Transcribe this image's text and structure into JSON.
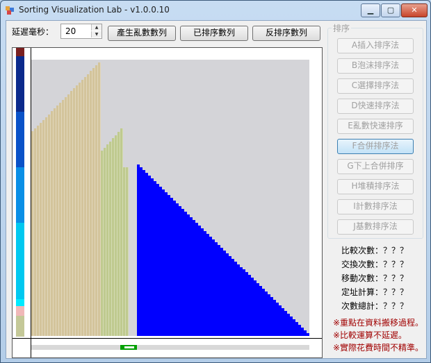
{
  "window": {
    "title": "Sorting Visualization Lab - v1.0.0.10",
    "minimize": "▁",
    "maximize": "▢",
    "close": "✕"
  },
  "delay": {
    "label": "延遲毫秒：",
    "value": "20",
    "up": "▲",
    "down": "▼"
  },
  "toolbar": {
    "random": "產生亂數數列",
    "sorted": "已排序數列",
    "reversed": "反排序數列"
  },
  "sort_group": {
    "title": "排序",
    "buttons": [
      {
        "label": "A插入排序法",
        "active": false
      },
      {
        "label": "B泡沫排序法",
        "active": false
      },
      {
        "label": "C選擇排序法",
        "active": false
      },
      {
        "label": "D快速排序法",
        "active": false
      },
      {
        "label": "E亂數快速排序",
        "active": false
      },
      {
        "label": "F合併排序法",
        "active": true
      },
      {
        "label": "G下上合併排序",
        "active": false
      },
      {
        "label": "H堆積排序法",
        "active": false
      },
      {
        "label": "I計數排序法",
        "active": false
      },
      {
        "label": "J基數排序法",
        "active": false
      }
    ]
  },
  "stats": [
    "比較次數：？？？",
    "交換次數：？？？",
    "移動次數：？？？",
    "定址計算：？？？",
    "次數總計：？？？"
  ],
  "notes": [
    "※重點在資料搬移過程。",
    "※比較運算不延遲。",
    "※實際花費時間不精準。"
  ],
  "colors": {
    "tan": "#d3c49b",
    "olive": "#bfca8f",
    "blue": "#0000ff",
    "bg": "#d4d4d8",
    "progress": "#00a000"
  },
  "progress": 0.06
}
